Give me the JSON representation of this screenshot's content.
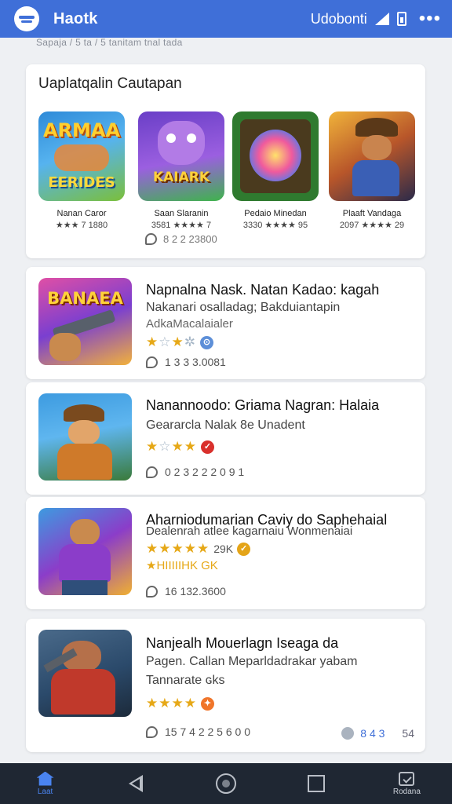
{
  "app": {
    "title": "Haotk",
    "status_text": "Udobonti"
  },
  "breadcrumb": "Sapaja / 5 ta / 5 tanitam tnal tada",
  "featured": {
    "title": "Uaplatqalin Cautapan",
    "downloads": "8 2 2 23800",
    "tiles": [
      {
        "name": "Nanan Caror",
        "meta": "★★★ 7 1880",
        "art_text": "ARMAA",
        "art_sub": "EERIDES",
        "icon": "adventure-icon",
        "colors": [
          "#f3b531",
          "#2e8ad8"
        ]
      },
      {
        "name": "Saan Slaranin",
        "meta": "3581 ★★★★ 7",
        "art_text": "KAIARK",
        "art_sub": "",
        "icon": "monster-icon",
        "colors": [
          "#8f4fd6",
          "#3fb34c"
        ]
      },
      {
        "name": "Pedaio Minedan",
        "meta": "3330 ★★★★ 95",
        "art_text": "",
        "art_sub": "",
        "icon": "portal-icon",
        "colors": [
          "#2f7a2f",
          "#f05a9d"
        ]
      },
      {
        "name": "Plaaft Vandaga",
        "meta": "2097 ★★★★ 29",
        "art_text": "",
        "art_sub": "",
        "icon": "gunslinger-icon",
        "colors": [
          "#d6762c",
          "#3a5fb5"
        ]
      }
    ]
  },
  "items": [
    {
      "title": "Napnalna Nask. Natan Kadao: kagah",
      "subtitle": "Nakanari osalladag; Bakduiantapin",
      "line3": "AdkaMacalaialer",
      "rating_stars": 3,
      "rating_text": "",
      "badge": "⊙",
      "badge_color": "#5d8fd8",
      "downloads": "1 3 3 3.0081",
      "stat": "",
      "art_text": "BANAEA",
      "colors": [
        "#e04fa5",
        "#f2b13b"
      ]
    },
    {
      "title": "Nanannoodo: Griama Nagran: Halaia",
      "subtitle": "Geararcla Nalak 8e Unadent",
      "line3": "",
      "rating_stars": 3,
      "rating_text": "",
      "badge": "✓",
      "badge_color": "#d9302c",
      "downloads": "0 2 3 2 2 2 0 9 1",
      "stat": "",
      "art_text": "",
      "colors": [
        "#3d9be0",
        "#cf7a2a"
      ]
    },
    {
      "title": "Aharniodumarian Caviy do Saphehaial",
      "subtitle": "Dealenrah atlee kagarnaiu Wonmenaiai",
      "line3": "★HIIIIIHK GK",
      "rating_stars": 5,
      "rating_text": "29K",
      "badge": "✓",
      "badge_color": "#e4a418",
      "downloads": "16 132.3600",
      "stat": "",
      "art_text": "",
      "colors": [
        "#8b3dc9",
        "#f0b030"
      ]
    },
    {
      "title": "Nanjealh  Mouerlagn Iseaga da",
      "subtitle": "Pagen. Callan Meparldadrakar yabam",
      "line3": "Tannarate ɢks",
      "rating_stars": 4,
      "rating_text": "",
      "badge": "✦",
      "badge_color": "#f0752a",
      "downloads": "15 7 4 2 2 5 6 0 0",
      "stat": "8 4 3",
      "stat2": "54",
      "art_text": "",
      "colors": [
        "#c0392b",
        "#2b4a6b"
      ]
    }
  ],
  "nav": [
    {
      "label": "Laat",
      "icon": "home-icon",
      "active": true
    },
    {
      "label": "",
      "icon": "back-icon"
    },
    {
      "label": "",
      "icon": "home-circle-icon"
    },
    {
      "label": "",
      "icon": "recents-icon"
    },
    {
      "label": "Rodana",
      "icon": "inbox-icon"
    }
  ],
  "colors": {
    "appbar": "#3f6fd8",
    "navbar": "#1f2733",
    "star": "#e6a817"
  }
}
